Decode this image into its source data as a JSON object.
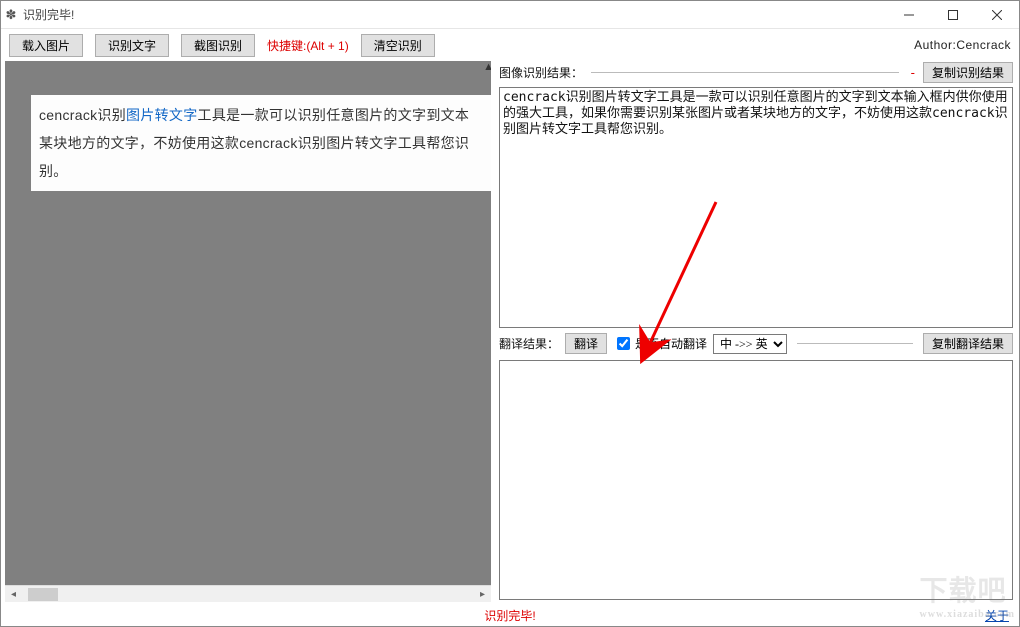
{
  "window": {
    "title": "识别完毕!"
  },
  "toolbar": {
    "load_image": "载入图片",
    "recognize_text": "识别文字",
    "screenshot_recognize": "截图识别",
    "shortcut_label": "快捷键:(Alt + 1)",
    "clear_recognize": "清空识别",
    "author": "Author:Cencrack"
  },
  "left": {
    "sample_prefix": "cencrack识别",
    "sample_link": "图片转文字",
    "sample_after_link": "工具是一款可以识别任意图片的文字到文本",
    "sample_line2": "某块地方的文字，不妨使用这款cencrack识别图片转文字工具帮您识别。"
  },
  "right": {
    "result_label": "图像识别结果：",
    "copy_result": "复制识别结果",
    "result_text": "cencrack识别图片转文字工具是一款可以识别任意图片的文字到文本输入框内供你使用的强大工具，如果你需要识别某张图片或者某块地方的文字，不妨使用这款cencrack识别图片转文字工具帮您识别。",
    "translate_label": "翻译结果：",
    "translate_btn": "翻译",
    "auto_translate_label": "是否自动翻译",
    "auto_translate_checked": true,
    "direction_selected": "中 ->> 英",
    "copy_translate": "复制翻译结果",
    "translate_text": ""
  },
  "footer": {
    "status": "识别完毕!",
    "about": "关于"
  },
  "watermark": {
    "big": "下载吧",
    "small": "www.xiazaiba.com"
  }
}
